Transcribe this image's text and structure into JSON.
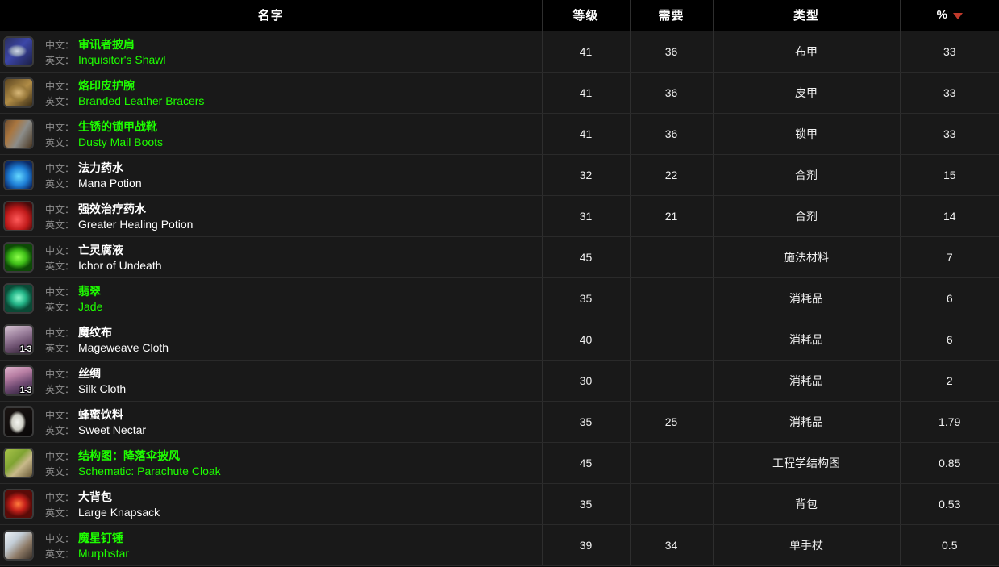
{
  "table": {
    "headers": {
      "name": "名字",
      "level": "等级",
      "required": "需要",
      "type": "类型",
      "percent": "%"
    },
    "sort": {
      "column": "percent",
      "direction": "desc",
      "icon": "caret-down-icon",
      "color": "#c0392b"
    },
    "labels": {
      "chinese": "中文：",
      "english": "英文："
    },
    "quality_colors": {
      "common": "#ffffff",
      "uncommon": "#1eff00"
    },
    "rows": [
      {
        "icon": "item-icon-inquisitors-shawl",
        "art": "art-shawl",
        "quantity": "",
        "name_cn": "审讯者披肩",
        "name_en": "Inquisitor's Shawl",
        "quality": "uncommon",
        "level": "41",
        "required": "36",
        "type": "布甲",
        "percent": "33"
      },
      {
        "icon": "item-icon-branded-leather-bracers",
        "art": "art-bracers",
        "quantity": "",
        "name_cn": "烙印皮护腕",
        "name_en": "Branded Leather Bracers",
        "quality": "uncommon",
        "level": "41",
        "required": "36",
        "type": "皮甲",
        "percent": "33"
      },
      {
        "icon": "item-icon-dusty-mail-boots",
        "art": "art-boots",
        "quantity": "",
        "name_cn": "生锈的锁甲战靴",
        "name_en": "Dusty Mail Boots",
        "quality": "uncommon",
        "level": "41",
        "required": "36",
        "type": "锁甲",
        "percent": "33"
      },
      {
        "icon": "item-icon-mana-potion",
        "art": "art-manapot",
        "quantity": "",
        "name_cn": "法力药水",
        "name_en": "Mana Potion",
        "quality": "common",
        "level": "32",
        "required": "22",
        "type": "合剂",
        "percent": "15"
      },
      {
        "icon": "item-icon-greater-healing-potion",
        "art": "art-healpot",
        "quantity": "",
        "name_cn": "强效治疗药水",
        "name_en": "Greater Healing Potion",
        "quality": "common",
        "level": "31",
        "required": "21",
        "type": "合剂",
        "percent": "14"
      },
      {
        "icon": "item-icon-ichor-of-undeath",
        "art": "art-ichor",
        "quantity": "",
        "name_cn": "亡灵腐液",
        "name_en": "Ichor of Undeath",
        "quality": "common",
        "level": "45",
        "required": "",
        "type": "施法材料",
        "percent": "7"
      },
      {
        "icon": "item-icon-jade",
        "art": "art-jade",
        "quantity": "",
        "name_cn": "翡翠",
        "name_en": "Jade",
        "quality": "uncommon",
        "level": "35",
        "required": "",
        "type": "消耗品",
        "percent": "6"
      },
      {
        "icon": "item-icon-mageweave-cloth",
        "art": "art-mageweave",
        "quantity": "1-3",
        "name_cn": "魔纹布",
        "name_en": "Mageweave Cloth",
        "quality": "common",
        "level": "40",
        "required": "",
        "type": "消耗品",
        "percent": "6"
      },
      {
        "icon": "item-icon-silk-cloth",
        "art": "art-silk",
        "quantity": "1-3",
        "name_cn": "丝绸",
        "name_en": "Silk Cloth",
        "quality": "common",
        "level": "30",
        "required": "",
        "type": "消耗品",
        "percent": "2"
      },
      {
        "icon": "item-icon-sweet-nectar",
        "art": "art-nectar",
        "quantity": "",
        "name_cn": "蜂蜜饮料",
        "name_en": "Sweet Nectar",
        "quality": "common",
        "level": "35",
        "required": "25",
        "type": "消耗品",
        "percent": "1.79"
      },
      {
        "icon": "item-icon-schematic-parachute-cloak",
        "art": "art-schematic",
        "quantity": "",
        "name_cn": "结构图：降落伞披风",
        "name_en": "Schematic: Parachute Cloak",
        "quality": "uncommon",
        "level": "45",
        "required": "",
        "type": "工程学结构图",
        "percent": "0.85"
      },
      {
        "icon": "item-icon-large-knapsack",
        "art": "art-knapsack",
        "quantity": "",
        "name_cn": "大背包",
        "name_en": "Large Knapsack",
        "quality": "common",
        "level": "35",
        "required": "",
        "type": "背包",
        "percent": "0.53"
      },
      {
        "icon": "item-icon-murphstar",
        "art": "art-murphstar",
        "quantity": "",
        "name_cn": "魔星钉锤",
        "name_en": "Murphstar",
        "quality": "uncommon",
        "level": "39",
        "required": "34",
        "type": "单手杖",
        "percent": "0.5"
      }
    ]
  }
}
